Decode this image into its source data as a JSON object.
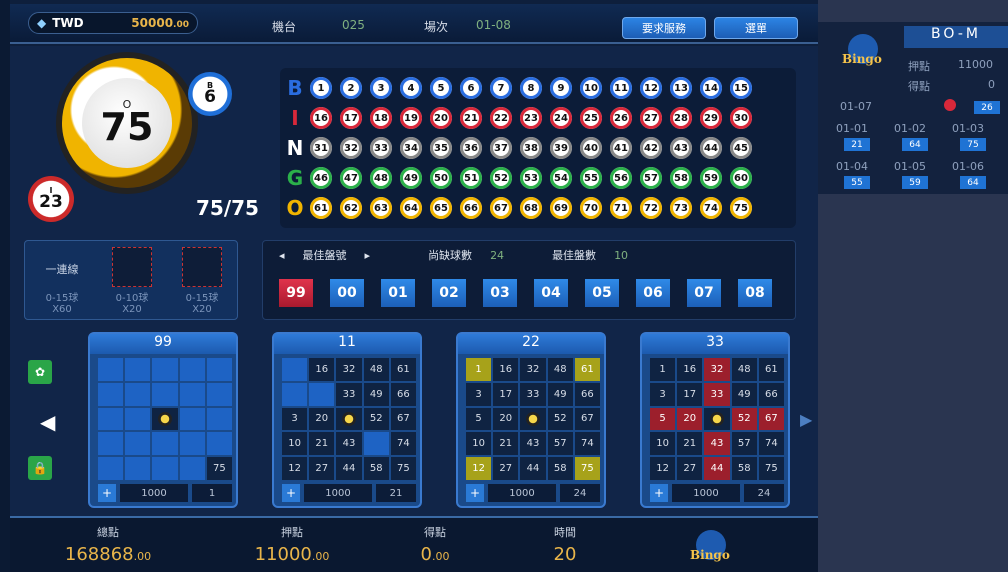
{
  "top": {
    "currency": "TWD",
    "balance": "50000",
    "balance_cents": ".00",
    "machine_label": "機台",
    "machine_value": "025",
    "round_label": "場次",
    "round_value": "01-08",
    "service_btn": "要求服務",
    "menu_btn": "選單"
  },
  "draw": {
    "main_letter": "O",
    "main_number": "75",
    "prev1_letter": "B",
    "prev1_number": "6",
    "prev2_letter": "I",
    "prev2_number": "23",
    "count": "75/75"
  },
  "board": {
    "rows": [
      {
        "letter": "B",
        "color": "#2a6de0",
        "numbers": [
          "1",
          "2",
          "3",
          "4",
          "5",
          "6",
          "7",
          "8",
          "9",
          "10",
          "11",
          "12",
          "13",
          "14",
          "15"
        ]
      },
      {
        "letter": "I",
        "color": "#d8283a",
        "numbers": [
          "16",
          "17",
          "18",
          "19",
          "20",
          "21",
          "22",
          "23",
          "24",
          "25",
          "26",
          "27",
          "28",
          "29",
          "30"
        ]
      },
      {
        "letter": "N",
        "color": "#ffffff",
        "numbers": [
          "31",
          "32",
          "33",
          "34",
          "35",
          "36",
          "37",
          "38",
          "39",
          "40",
          "41",
          "42",
          "43",
          "44",
          "45"
        ]
      },
      {
        "letter": "G",
        "color": "#2bb04a",
        "numbers": [
          "46",
          "47",
          "48",
          "49",
          "50",
          "51",
          "52",
          "53",
          "54",
          "55",
          "56",
          "57",
          "58",
          "59",
          "60"
        ]
      },
      {
        "letter": "O",
        "color": "#f0b400",
        "numbers": [
          "61",
          "62",
          "63",
          "64",
          "65",
          "66",
          "67",
          "68",
          "69",
          "70",
          "71",
          "72",
          "73",
          "74",
          "75"
        ]
      }
    ]
  },
  "patterns": [
    {
      "title": "一連線",
      "range": "0-15球",
      "mult": "X60"
    },
    {
      "title": "",
      "range": "0-10球",
      "mult": "X20"
    },
    {
      "title": "",
      "range": "0-15球",
      "mult": "X20"
    }
  ],
  "best": {
    "best_card_label": "最佳盤號",
    "missing_label": "尚缺球數",
    "missing_value": "24",
    "best_count_label": "最佳盤數",
    "best_count_value": "10",
    "cards": [
      "99",
      "00",
      "01",
      "02",
      "03",
      "04",
      "05",
      "06",
      "07",
      "08"
    ]
  },
  "cards": [
    {
      "id": "99",
      "bet": "1000",
      "score": "1",
      "cells": [
        "",
        "",
        "",
        "",
        "",
        "",
        "",
        "",
        "",
        "",
        "",
        "",
        "*",
        "",
        "",
        "",
        "",
        "",
        "",
        "",
        "",
        "",
        "",
        "",
        "75"
      ]
    },
    {
      "id": "11",
      "bet": "1000",
      "score": "21",
      "cells": [
        "",
        "16",
        "32",
        "48",
        "61",
        "",
        "",
        "33",
        "49",
        "66",
        "3",
        "20",
        "*",
        "52",
        "67",
        "10",
        "21",
        "43",
        "",
        "74",
        "12",
        "27",
        "44",
        "58",
        "75"
      ]
    },
    {
      "id": "22",
      "bet": "1000",
      "score": "24",
      "cells": [
        "1",
        "16",
        "32",
        "48",
        "61",
        "3",
        "17",
        "33",
        "49",
        "66",
        "5",
        "20",
        "*",
        "52",
        "67",
        "10",
        "21",
        "43",
        "57",
        "74",
        "12",
        "27",
        "44",
        "58",
        "75"
      ]
    },
    {
      "id": "33",
      "bet": "1000",
      "score": "24",
      "cells": [
        "1",
        "16",
        "32",
        "48",
        "61",
        "3",
        "17",
        "33",
        "49",
        "66",
        "5",
        "20",
        "*",
        "52",
        "67",
        "10",
        "21",
        "43",
        "57",
        "74",
        "12",
        "27",
        "44",
        "58",
        "75"
      ]
    }
  ],
  "bottom": {
    "total_label": "總點",
    "total_value": "168868",
    "total_cents": ".00",
    "bet_label": "押點",
    "bet_value": "11000",
    "bet_cents": ".00",
    "win_label": "得點",
    "win_value": "0",
    "win_cents": ".00",
    "time_label": "時間",
    "time_value": "20",
    "logo_text": "Bingo"
  },
  "right": {
    "title": "BO-M",
    "logo_text": "Bingo",
    "bet_label": "押點",
    "bet_value": "11000",
    "win_label": "得點",
    "win_value": "0",
    "current_round": "01-07",
    "current_ball": "26",
    "history": [
      {
        "round": "01-01",
        "value": "21"
      },
      {
        "round": "01-02",
        "value": "64"
      },
      {
        "round": "01-03",
        "value": "75"
      },
      {
        "round": "01-04",
        "value": "55"
      },
      {
        "round": "01-05",
        "value": "59"
      },
      {
        "round": "01-06",
        "value": "64"
      }
    ]
  }
}
